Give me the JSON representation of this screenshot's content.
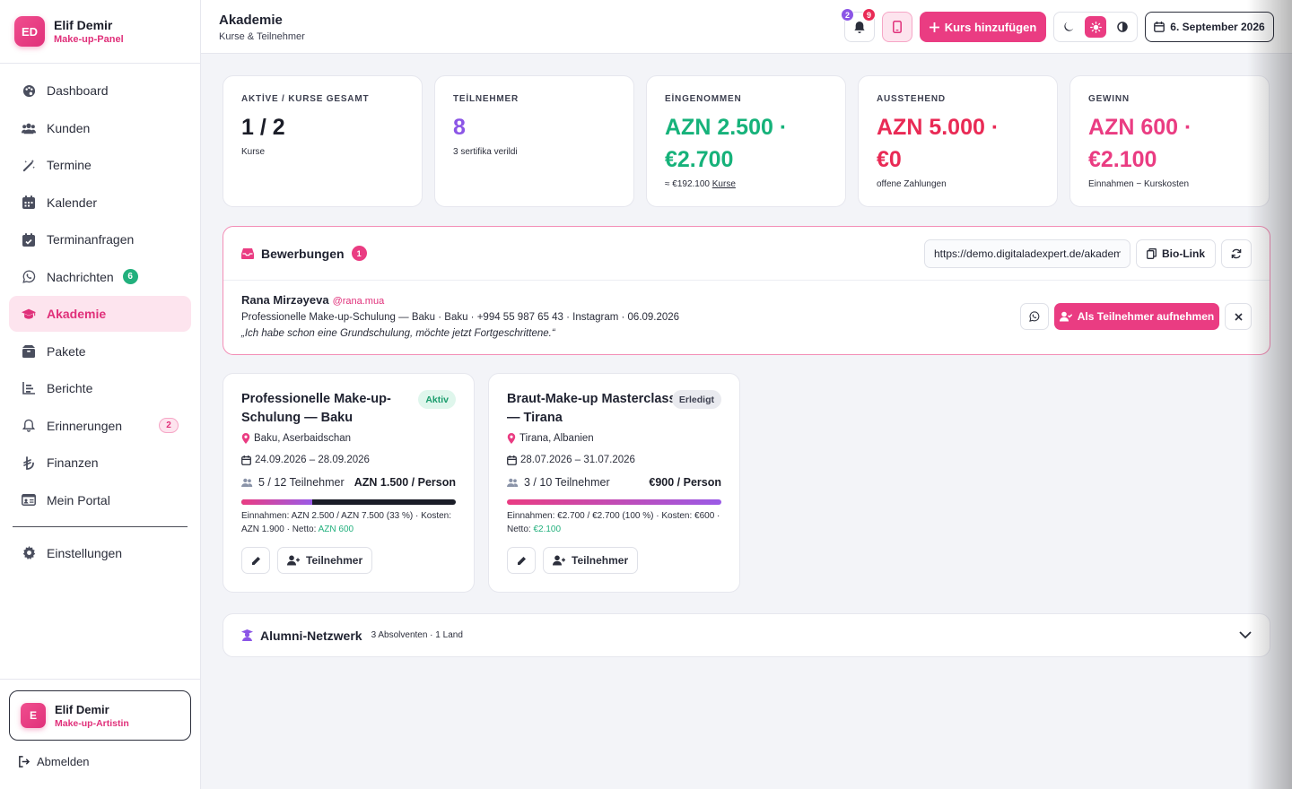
{
  "brand": {
    "initials": "ED",
    "name": "Elif Demir",
    "subtitle": "Make-up-Panel"
  },
  "sidebar": {
    "items": [
      {
        "label": "Dashboard",
        "icon": "palette-icon"
      },
      {
        "label": "Kunden",
        "icon": "users-icon"
      },
      {
        "label": "Termine",
        "icon": "magic-wand-icon"
      },
      {
        "label": "Kalender",
        "icon": "calendar-icon"
      },
      {
        "label": "Terminanfragen",
        "icon": "calendar-check-icon"
      },
      {
        "label": "Nachrichten",
        "icon": "whatsapp-icon",
        "badge": "6"
      },
      {
        "label": "Akademie",
        "icon": "graduation-cap-icon",
        "active": true
      },
      {
        "label": "Pakete",
        "icon": "box-icon"
      },
      {
        "label": "Berichte",
        "icon": "chart-icon"
      },
      {
        "label": "Erinnerungen",
        "icon": "bell-icon",
        "badge": "2"
      },
      {
        "label": "Finanzen",
        "icon": "lira-icon"
      },
      {
        "label": "Mein Portal",
        "icon": "id-card-icon"
      }
    ],
    "settings_label": "Einstellungen",
    "user": {
      "initial": "E",
      "name": "Elif Demir",
      "role": "Make-up-Artistin"
    },
    "logout_label": "Abmelden"
  },
  "header": {
    "title": "Akademie",
    "subtitle": "Kurse & Teilnehmer",
    "bell_badge_purple": "2",
    "bell_badge_red": "9",
    "add_button": "Kurs hinzufügen",
    "date": "6. September 2026"
  },
  "stats": [
    {
      "label": "AKTİVE / KURSE GESAMT",
      "value": "1 / 2",
      "note": "Kurse",
      "color": "#1b1d28"
    },
    {
      "label": "TEİLNEHMER",
      "value": "8",
      "note": "3 sertifika verildi",
      "color": "#8b55e6"
    },
    {
      "label": "EİNGENOMMEN",
      "value": "AZN 2.500 ·",
      "value2": "€2.700",
      "note": "≈ €192.100",
      "note_link": "Kurse",
      "color": "#16b27a"
    },
    {
      "label": "AUSSTEHEND",
      "value": "AZN 5.000 ·",
      "value2": "€0",
      "note": "offene Zahlungen",
      "color": "#e92a55"
    },
    {
      "label": "GEWINN",
      "value": "AZN 600 ·",
      "value2": "€2.100",
      "note": "Einnahmen − Kurskosten",
      "color": "#ea3c82"
    }
  ],
  "applications": {
    "title": "Bewerbungen",
    "count": "1",
    "link_value": "https://demo.digitaladexpert.de/akademie",
    "biolink_label": "Bio-Link",
    "items": [
      {
        "name": "Rana Mirzəyeva",
        "handle": "@rana.mua",
        "meta": "Professionelle Make-up-Schulung — Baku · Baku · +994 55 987 65 43 · Instagram · 06.09.2026",
        "quote": "„Ich habe schon eine Grundschulung, möchte jetzt Fortgeschrittene.“",
        "accept_label": "Als Teilnehmer aufnehmen"
      }
    ]
  },
  "courses": [
    {
      "title": "Professionelle Make-up-Schulung — Baku",
      "status": "Aktiv",
      "location": "Baku, Aserbaidschan",
      "dates": "24.09.2026 – 28.09.2026",
      "participants": "5 / 12 Teilnehmer",
      "price": "AZN 1.500 / Person",
      "progress": 0.33,
      "finance": "Einnahmen: AZN 2.500 / AZN 7.500 (33 %) · Kosten: AZN 1.900 · Netto: ",
      "net": "AZN 600",
      "participants_button": "Teilnehmer"
    },
    {
      "title": "Braut-Make-up Masterclass — Tirana",
      "status": "Erledigt",
      "location": "Tirana, Albanien",
      "dates": "28.07.2026 – 31.07.2026",
      "participants": "3 / 10 Teilnehmer",
      "price": "€900 / Person",
      "progress": 1.0,
      "finance": "Einnahmen: €2.700 / €2.700 (100 %) · Kosten: €600 · Netto: ",
      "net": "€2.100",
      "participants_button": "Teilnehmer"
    }
  ],
  "alumni": {
    "title": "Alumni-Netzwerk",
    "meta": "3 Absolventen · 1 Land"
  },
  "colors": {
    "accent": "#ea3c82",
    "green": "#22b07d",
    "purple": "#8b55e6",
    "red": "#e92a55"
  }
}
